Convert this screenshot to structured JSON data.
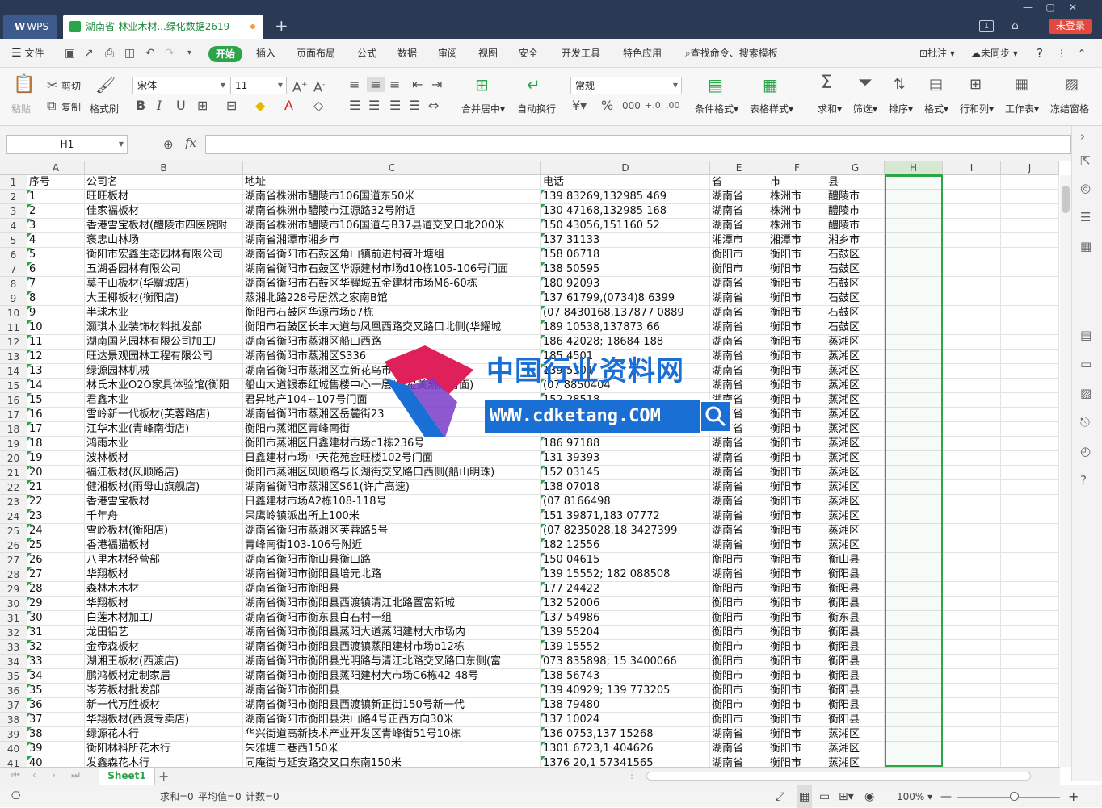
{
  "titlebar": {
    "wps_label": "WPS",
    "doc_tab": "湖南省-林业木材...绿化数据2619",
    "new_tab": "+",
    "login": "未登录",
    "badge": "1"
  },
  "menu": {
    "file": "文件",
    "items": [
      "开始",
      "插入",
      "页面布局",
      "公式",
      "数据",
      "审阅",
      "视图",
      "安全",
      "开发工具",
      "特色应用"
    ],
    "search": "查找命令、搜索模板",
    "comment": "批注",
    "sync": "未同步",
    "help": "?"
  },
  "ribbon": {
    "paste": "粘贴",
    "cut": "剪切",
    "copy": "复制",
    "format_painter": "格式刷",
    "font_name": "宋体",
    "font_size": "11",
    "merge": "合并居中",
    "wrap": "自动换行",
    "number_format": "常规",
    "cond_format": "条件格式",
    "table_style": "表格样式",
    "sum": "求和",
    "filter": "筛选",
    "sort": "排序",
    "format": "格式",
    "rowcol": "行和列",
    "worksheet": "工作表",
    "freeze": "冻结窗格"
  },
  "formula_bar": {
    "name_box": "H1",
    "fx": "fx"
  },
  "grid": {
    "columns": [
      "A",
      "B",
      "C",
      "D",
      "E",
      "F",
      "G",
      "H",
      "I",
      "J"
    ],
    "selected_column": "H",
    "header": [
      "序号",
      "公司名",
      "地址",
      "电话",
      "省",
      "市",
      "县"
    ],
    "rows": [
      [
        "1",
        "旺旺板材",
        "湖南省株洲市醴陵市106国道东50米",
        "139      83269,132985      469",
        "湖南省",
        "株洲市",
        "醴陵市"
      ],
      [
        "2",
        "佳家福板材",
        "湖南省株洲市醴陵市江源路32号附近",
        "130      47168,132985      168",
        "湖南省",
        "株洲市",
        "醴陵市"
      ],
      [
        "3",
        "香港雪宝板材(醴陵市四医院附",
        "湖南省株洲市醴陵市106国道与B37县道交叉口北200米",
        "150      43056,151160      52",
        "湖南省",
        "株洲市",
        "醴陵市"
      ],
      [
        "4",
        "褒忠山林场",
        "湖南省湘潭市湘乡市",
        "137      31133",
        "湘潭市",
        "湘潭市",
        "湘乡市"
      ],
      [
        "5",
        "衡阳市宏鑫生态园林有限公司",
        "湖南省衡阳市石鼓区角山镇前进村荷叶塘组",
        "158      06718",
        "衡阳市",
        "衡阳市",
        "石鼓区"
      ],
      [
        "6",
        "五湖香园林有限公司",
        "湖南省衡阳市石鼓区华源建材市场d10栋105-106号门面",
        "138      50595",
        "衡阳市",
        "衡阳市",
        "石鼓区"
      ],
      [
        "7",
        "莫干山板材(华耀城店)",
        "湖南省衡阳市石鼓区华耀城五金建材市场M6-60栋",
        "180      92093",
        "湖南省",
        "衡阳市",
        "石鼓区"
      ],
      [
        "8",
        "大王椰板材(衡阳店)",
        "蒸湘北路228号居然之家南B馆",
        "137      61799,(0734)8      6399",
        "湖南省",
        "衡阳市",
        "石鼓区"
      ],
      [
        "9",
        "半球木业",
        "衡阳市石鼓区华源市场b7栋",
        "(07      8430168,137877      0889",
        "湖南省",
        "衡阳市",
        "石鼓区"
      ],
      [
        "10",
        "灏琪木业装饰材料批发部",
        "衡阳市石鼓区长丰大道与凤凰西路交叉路口北侧(华耀城",
        "189      10538,137873      66",
        "湖南省",
        "衡阳市",
        "石鼓区"
      ],
      [
        "11",
        "湖南国艺园林有限公司加工厂",
        "湖南省衡阳市蒸湘区船山西路",
        "186      42028; 18684      188",
        "湖南省",
        "衡阳市",
        "蒸湘区"
      ],
      [
        "12",
        "旺达景观园林工程有限公司",
        "湖南省衡阳市蒸湘区S336",
        "185      4501",
        "湖南省",
        "衡阳市",
        "蒸湘区"
      ],
      [
        "13",
        "绿源园林机械",
        "湖南省衡阳市蒸湘区立新花鸟市场3栋",
        "139      5301",
        "湖南省",
        "衡阳市",
        "蒸湘区"
      ],
      [
        "14",
        "林氏木业O2O家具体验馆(衡阳",
        "船山大道银泰红城售楼中心一层(红星美凯龙对面)",
        "(07      8850404",
        "湖南省",
        "衡阳市",
        "蒸湘区"
      ],
      [
        "15",
        "君鑫木业",
        "君昇地产104~107号门面",
        "152      28518",
        "湖南省",
        "衡阳市",
        "蒸湘区"
      ],
      [
        "16",
        "雪岭新一代板材(芙蓉路店)",
        "湖南省衡阳市蒸湘区岳麓街23",
        "135      1123",
        "湖南省",
        "衡阳市",
        "蒸湘区"
      ],
      [
        "17",
        "江华木业(青峰南街店)",
        "衡阳市蒸湘区青峰南街",
        "138      48210",
        "湖南省",
        "衡阳市",
        "蒸湘区"
      ],
      [
        "18",
        "鸿雨木业",
        "衡阳市蒸湘区日鑫建材市场c1栋236号",
        "186      97188",
        "湖南省",
        "衡阳市",
        "蒸湘区"
      ],
      [
        "19",
        "波林板材",
        "日鑫建材市场中天花苑金旺楼102号门面",
        "131      39393",
        "湖南省",
        "衡阳市",
        "蒸湘区"
      ],
      [
        "20",
        "福江板材(风顺路店)",
        "衡阳市蒸湘区风顺路与长湖街交叉路口西侧(船山明珠)",
        "152      03145",
        "湖南省",
        "衡阳市",
        "蒸湘区"
      ],
      [
        "21",
        "健湘板材(雨母山旗舰店)",
        "湖南省衡阳市蒸湘区S61(许广高速)",
        "138      07018",
        "湖南省",
        "衡阳市",
        "蒸湘区"
      ],
      [
        "22",
        "香港雪宝板材",
        "日鑫建材市场A2栋108-118号",
        "(07      8166498",
        "湖南省",
        "衡阳市",
        "蒸湘区"
      ],
      [
        "23",
        "千年舟",
        "呆鹰岭镇派出所上100米",
        "151      39871,183      07772",
        "湖南省",
        "衡阳市",
        "蒸湘区"
      ],
      [
        "24",
        "雪岭板材(衡阳店)",
        "湖南省衡阳市蒸湘区芙蓉路5号",
        "(07      8235028,18      3427399",
        "湖南省",
        "衡阳市",
        "蒸湘区"
      ],
      [
        "25",
        "香港福猫板材",
        "青峰南街103-106号附近",
        "182      12556",
        "湖南省",
        "衡阳市",
        "蒸湘区"
      ],
      [
        "26",
        "八里木材经营部",
        "湖南省衡阳市衡山县衡山路",
        "150      04615",
        "衡阳市",
        "衡阳市",
        "衡山县"
      ],
      [
        "27",
        "华翔板材",
        "湖南省衡阳市衡阳县培元北路",
        "139      15552; 182      088508",
        "湖南省",
        "衡阳市",
        "衡阳县"
      ],
      [
        "28",
        "森林木木材",
        "湖南省衡阳市衡阳县",
        "177      24422",
        "衡阳市",
        "衡阳市",
        "衡阳县"
      ],
      [
        "29",
        "华翔板材",
        "湖南省衡阳市衡阳县西渡镇清江北路置富新城",
        "132      52006",
        "衡阳市",
        "衡阳市",
        "衡阳县"
      ],
      [
        "30",
        "白莲木材加工厂",
        "湖南省衡阳市衡东县白石村一组",
        "137      54986",
        "衡阳市",
        "衡阳市",
        "衡东县"
      ],
      [
        "31",
        "龙田铝艺",
        "湖南省衡阳市衡阳县蒸阳大道蒸阳建材大市场内",
        "139      55204",
        "衡阳市",
        "衡阳市",
        "衡阳县"
      ],
      [
        "32",
        "金帝森板材",
        "湖南省衡阳市衡阳县西渡镇蒸阳建材市场b12栋",
        "139      15552",
        "衡阳市",
        "衡阳市",
        "衡阳县"
      ],
      [
        "33",
        "湖湘王板材(西渡店)",
        "湖南省衡阳市衡阳县光明路与清江北路交叉路口东侧(富",
        "073      835898; 15      3400066",
        "衡阳市",
        "衡阳市",
        "衡阳县"
      ],
      [
        "34",
        "鹏鸿板材定制家居",
        "湖南省衡阳市衡阳县蒸阳建材大市场C6栋42-48号",
        "138      56743",
        "衡阳市",
        "衡阳市",
        "衡阳县"
      ],
      [
        "35",
        "岑芳板材批发部",
        "湖南省衡阳市衡阳县",
        "139      40929; 139      773205",
        "衡阳市",
        "衡阳市",
        "衡阳县"
      ],
      [
        "36",
        "新一代万胜板材",
        "湖南省衡阳市衡阳县西渡镇新正街150号新一代",
        "138      79480",
        "衡阳市",
        "衡阳市",
        "衡阳县"
      ],
      [
        "37",
        "华翔板材(西渡专卖店)",
        "湖南省衡阳市衡阳县洪山路4号正西方向30米",
        "137      10024",
        "衡阳市",
        "衡阳市",
        "衡阳县"
      ],
      [
        "38",
        "绿源花木行",
        "华兴街道高新技术产业开发区青峰街51号10栋",
        "136      0753,137      15268",
        "湖南省",
        "衡阳市",
        "蒸湘区"
      ],
      [
        "39",
        "衡阳林科所花木行",
        "朱雅塘二巷西150米",
        "1301      6723,1      404626",
        "湖南省",
        "衡阳市",
        "蒸湘区"
      ],
      [
        "40",
        "发鑫森花木行",
        "同庵街与延安路交叉口东南150米",
        "1376      20,1      57341565",
        "湖南省",
        "衡阳市",
        "蒸湘区"
      ]
    ]
  },
  "watermark": {
    "title": "中国行业资料网",
    "url": "WWW.cdketang.COM"
  },
  "sheets": {
    "active": "Sheet1",
    "add": "+"
  },
  "status": {
    "sum": "求和=0",
    "avg": "平均值=0",
    "count": "计数=0",
    "zoom": "100%"
  },
  "colors": {
    "accent": "#2ca44a",
    "titlebar": "#2a3a54",
    "login": "#e2483d",
    "watermark": "#1a6fd4"
  }
}
